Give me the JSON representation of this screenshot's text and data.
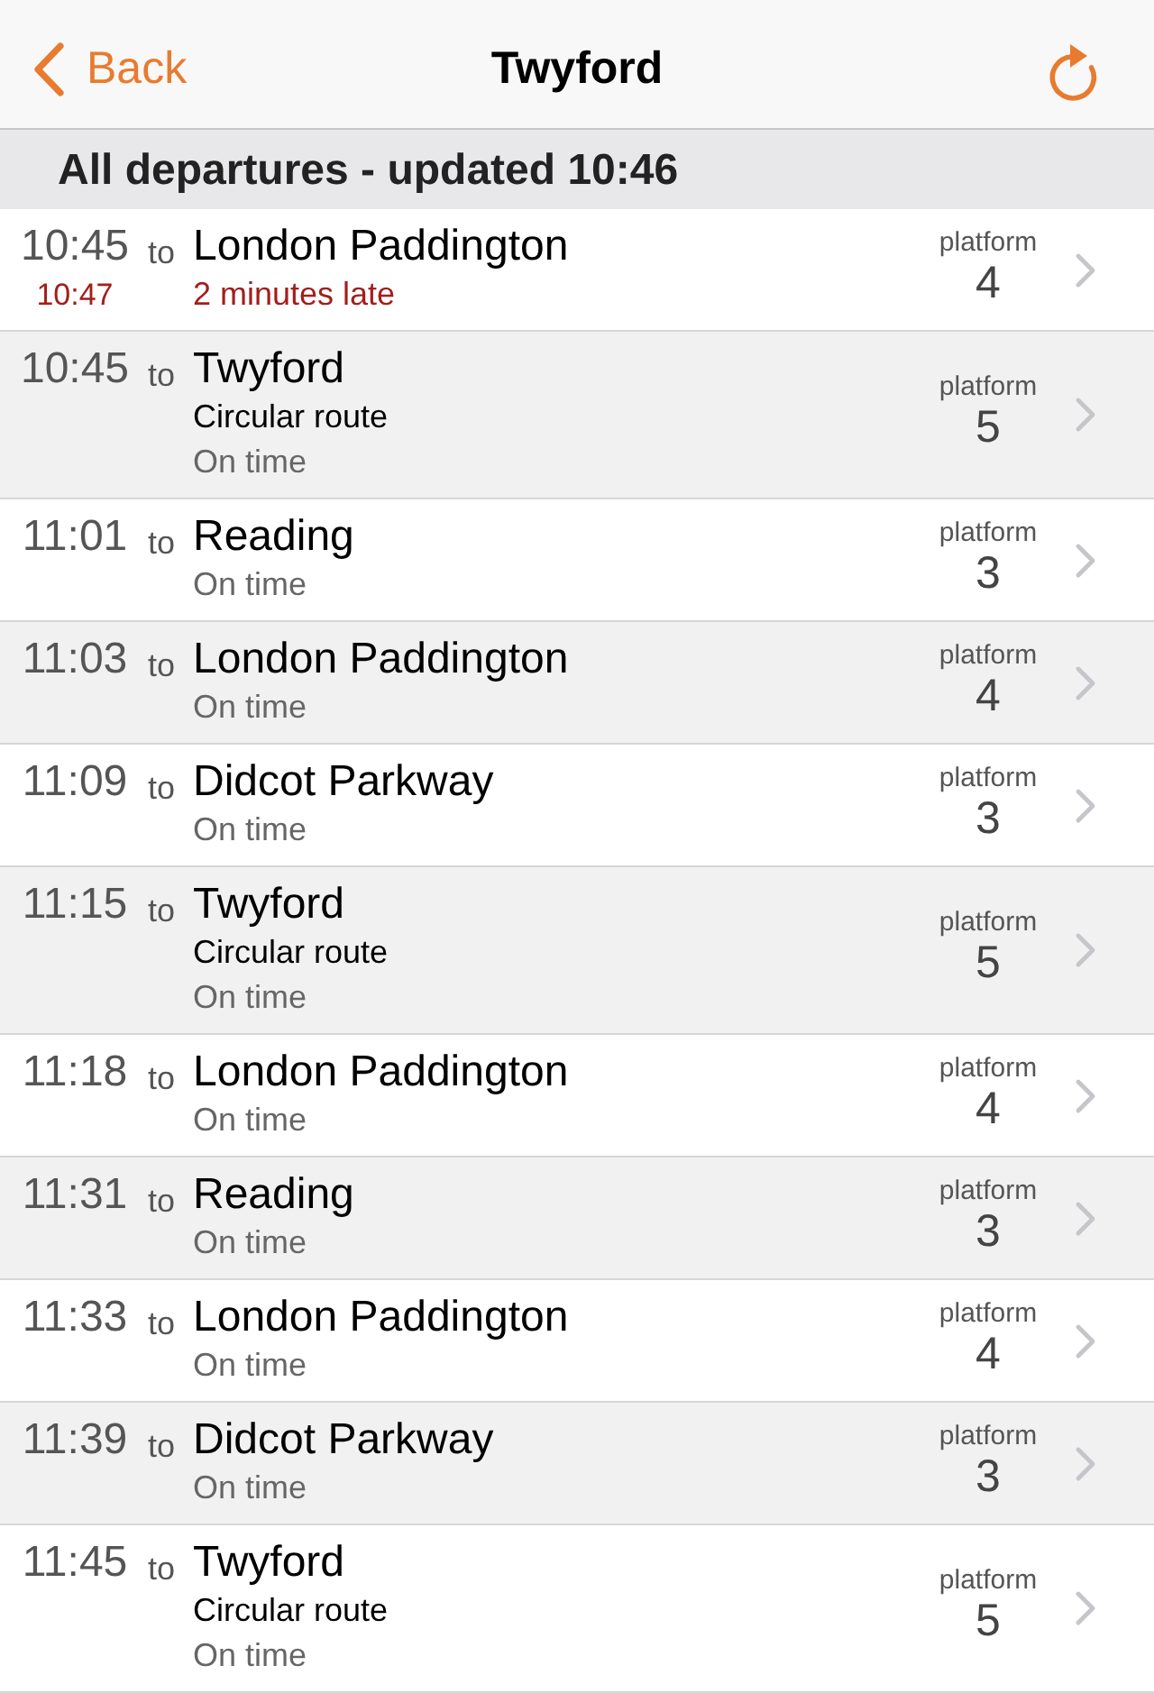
{
  "nav": {
    "back_label": "Back",
    "title": "Twyford"
  },
  "section": {
    "title": "All departures - updated 10:46"
  },
  "departures": [
    {
      "time": "10:45",
      "expected": "10:47",
      "to": "to",
      "destination": "London Paddington",
      "status": "2 minutes late",
      "delayed": true,
      "platform_label": "platform",
      "platform": "4"
    },
    {
      "time": "10:45",
      "to": "to",
      "destination": "Twyford",
      "via": "Circular route",
      "status": "On time",
      "delayed": false,
      "platform_label": "platform",
      "platform": "5"
    },
    {
      "time": "11:01",
      "to": "to",
      "destination": "Reading",
      "status": "On time",
      "delayed": false,
      "platform_label": "platform",
      "platform": "3"
    },
    {
      "time": "11:03",
      "to": "to",
      "destination": "London Paddington",
      "status": "On time",
      "delayed": false,
      "platform_label": "platform",
      "platform": "4"
    },
    {
      "time": "11:09",
      "to": "to",
      "destination": "Didcot Parkway",
      "status": "On time",
      "delayed": false,
      "platform_label": "platform",
      "platform": "3"
    },
    {
      "time": "11:15",
      "to": "to",
      "destination": "Twyford",
      "via": "Circular route",
      "status": "On time",
      "delayed": false,
      "platform_label": "platform",
      "platform": "5"
    },
    {
      "time": "11:18",
      "to": "to",
      "destination": "London Paddington",
      "status": "On time",
      "delayed": false,
      "platform_label": "platform",
      "platform": "4"
    },
    {
      "time": "11:31",
      "to": "to",
      "destination": "Reading",
      "status": "On time",
      "delayed": false,
      "platform_label": "platform",
      "platform": "3"
    },
    {
      "time": "11:33",
      "to": "to",
      "destination": "London Paddington",
      "status": "On time",
      "delayed": false,
      "platform_label": "platform",
      "platform": "4"
    },
    {
      "time": "11:39",
      "to": "to",
      "destination": "Didcot Parkway",
      "status": "On time",
      "delayed": false,
      "platform_label": "platform",
      "platform": "3"
    },
    {
      "time": "11:45",
      "to": "to",
      "destination": "Twyford",
      "via": "Circular route",
      "status": "On time",
      "delayed": false,
      "platform_label": "platform",
      "platform": "5"
    }
  ]
}
